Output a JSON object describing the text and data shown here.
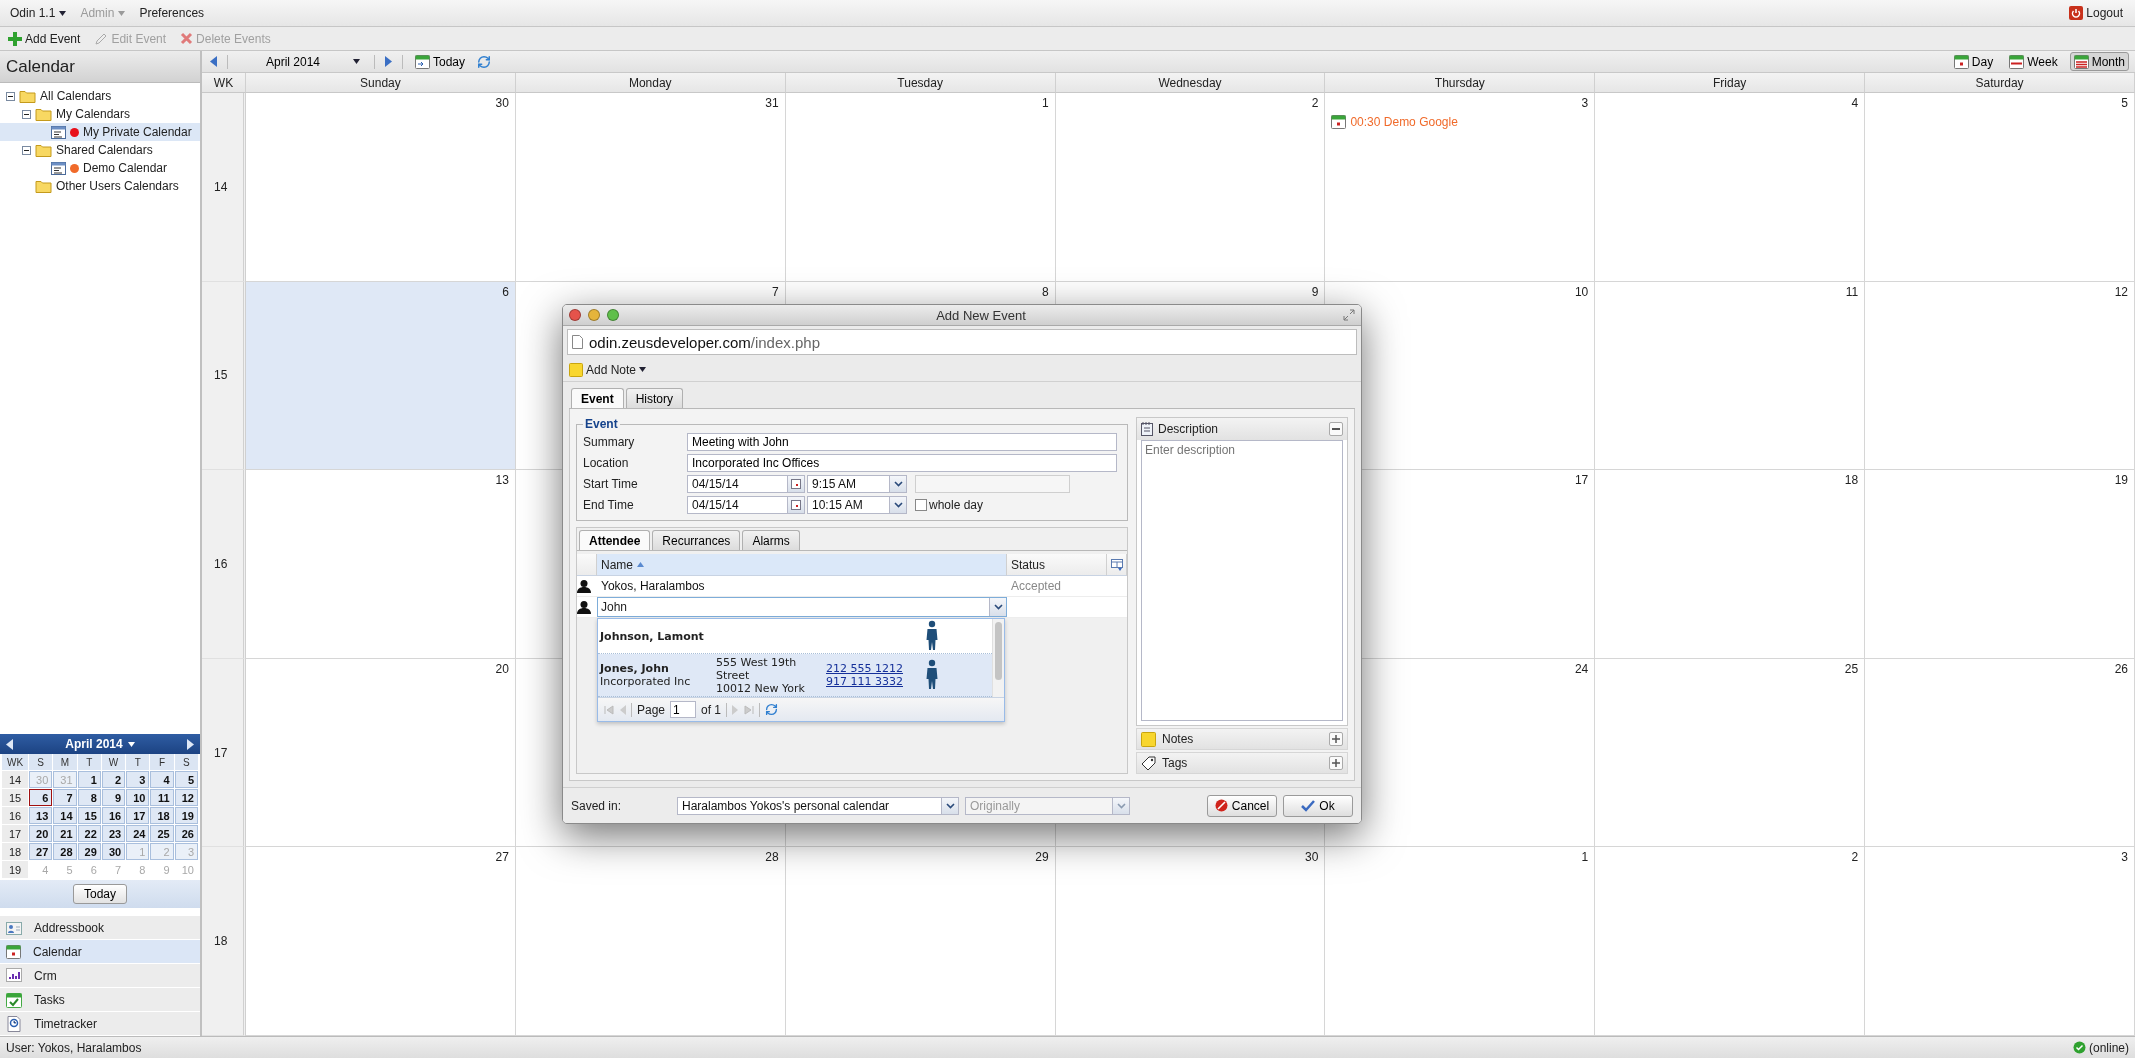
{
  "menu": [
    {
      "label": "Odin 1.1",
      "dropdown": true,
      "disabled": false
    },
    {
      "label": "Admin",
      "dropdown": true,
      "disabled": true
    },
    {
      "label": "Preferences",
      "dropdown": false,
      "disabled": false
    }
  ],
  "logout": {
    "label": "Logout"
  },
  "toolbar": [
    {
      "label": "Add Event",
      "kind": "add",
      "disabled": false
    },
    {
      "label": "Edit Event",
      "kind": "edit",
      "disabled": true
    },
    {
      "label": "Delete Events",
      "kind": "delete",
      "disabled": true
    }
  ],
  "sidebar": {
    "title": "Calendar",
    "tree": [
      {
        "label": "All Calendars",
        "kind": "folder",
        "expanded": true,
        "selected": false,
        "children": [
          {
            "label": "My Calendars",
            "kind": "folder",
            "expanded": true,
            "selected": false,
            "children": [
              {
                "label": "My Private Calendar",
                "kind": "calendar",
                "color": "#e8101a",
                "selected": true
              }
            ]
          },
          {
            "label": "Shared Calendars",
            "kind": "folder",
            "expanded": true,
            "selected": false,
            "children": [
              {
                "label": "Demo Calendar",
                "kind": "calendar",
                "color": "#f06a2a",
                "selected": false
              }
            ]
          },
          {
            "label": "Other Users Calendars",
            "kind": "folder",
            "selected": false
          }
        ]
      }
    ],
    "mini_calendar": {
      "title": "April 2014",
      "headers": [
        "WK",
        "S",
        "M",
        "T",
        "W",
        "T",
        "F",
        "S"
      ],
      "today_button": "Today",
      "weeks": [
        {
          "wk": "14",
          "days": [
            {
              "label": "30",
              "kind": "adjacent",
              "selected": false
            },
            {
              "label": "31",
              "kind": "adjacent",
              "selected": false
            },
            {
              "label": "1",
              "kind": "month",
              "selected": false
            },
            {
              "label": "2",
              "kind": "month",
              "selected": false
            },
            {
              "label": "3",
              "kind": "month",
              "selected": false
            },
            {
              "label": "4",
              "kind": "month",
              "selected": false
            },
            {
              "label": "5",
              "kind": "month",
              "selected": false
            }
          ]
        },
        {
          "wk": "15",
          "days": [
            {
              "label": "6",
              "kind": "month",
              "selected": true
            },
            {
              "label": "7",
              "kind": "month",
              "selected": false
            },
            {
              "label": "8",
              "kind": "month",
              "selected": false
            },
            {
              "label": "9",
              "kind": "month",
              "selected": false
            },
            {
              "label": "10",
              "kind": "month",
              "selected": false
            },
            {
              "label": "11",
              "kind": "month",
              "selected": false
            },
            {
              "label": "12",
              "kind": "month",
              "selected": false
            }
          ]
        },
        {
          "wk": "16",
          "days": [
            {
              "label": "13",
              "kind": "month",
              "selected": false
            },
            {
              "label": "14",
              "kind": "month",
              "selected": false
            },
            {
              "label": "15",
              "kind": "month",
              "selected": false
            },
            {
              "label": "16",
              "kind": "month",
              "selected": false
            },
            {
              "label": "17",
              "kind": "month",
              "selected": false
            },
            {
              "label": "18",
              "kind": "month",
              "selected": false
            },
            {
              "label": "19",
              "kind": "month",
              "selected": false
            }
          ]
        },
        {
          "wk": "17",
          "days": [
            {
              "label": "20",
              "kind": "month",
              "selected": false
            },
            {
              "label": "21",
              "kind": "month",
              "selected": false
            },
            {
              "label": "22",
              "kind": "month",
              "selected": false
            },
            {
              "label": "23",
              "kind": "month",
              "selected": false
            },
            {
              "label": "24",
              "kind": "month",
              "selected": false
            },
            {
              "label": "25",
              "kind": "month",
              "selected": false
            },
            {
              "label": "26",
              "kind": "month",
              "selected": false
            }
          ]
        },
        {
          "wk": "18",
          "days": [
            {
              "label": "27",
              "kind": "month",
              "selected": false
            },
            {
              "label": "28",
              "kind": "month",
              "selected": false
            },
            {
              "label": "29",
              "kind": "month",
              "selected": false
            },
            {
              "label": "30",
              "kind": "month",
              "selected": false
            },
            {
              "label": "1",
              "kind": "adjacent",
              "selected": false
            },
            {
              "label": "2",
              "kind": "adjacent",
              "selected": false
            },
            {
              "label": "3",
              "kind": "adjacent",
              "selected": false
            }
          ]
        },
        {
          "wk": "19",
          "days": [
            {
              "label": "4",
              "kind": "outside",
              "selected": false
            },
            {
              "label": "5",
              "kind": "outside",
              "selected": false
            },
            {
              "label": "6",
              "kind": "outside",
              "selected": false
            },
            {
              "label": "7",
              "kind": "outside",
              "selected": false
            },
            {
              "label": "8",
              "kind": "outside",
              "selected": false
            },
            {
              "label": "9",
              "kind": "outside",
              "selected": false
            },
            {
              "label": "10",
              "kind": "outside",
              "selected": false
            }
          ]
        }
      ]
    },
    "apps": [
      {
        "label": "Addressbook",
        "kind": "addressbook",
        "selected": false
      },
      {
        "label": "Calendar",
        "kind": "calendar",
        "selected": true
      },
      {
        "label": "Crm",
        "kind": "crm",
        "selected": false
      },
      {
        "label": "Tasks",
        "kind": "tasks",
        "selected": false
      },
      {
        "label": "Timetracker",
        "kind": "timetracker",
        "selected": false
      }
    ]
  },
  "calendar": {
    "month_label": "April 2014",
    "today_button": "Today",
    "views": [
      {
        "label": "Day",
        "kind": "day",
        "selected": false
      },
      {
        "label": "Week",
        "kind": "week",
        "selected": false
      },
      {
        "label": "Month",
        "kind": "month",
        "selected": true
      }
    ],
    "wk_header": "WK",
    "weekdays": [
      "Sunday",
      "Monday",
      "Tuesday",
      "Wednesday",
      "Thursday",
      "Friday",
      "Saturday"
    ],
    "weeks": [
      {
        "wk": "14",
        "days": [
          {
            "label": "30",
            "selected": false
          },
          {
            "label": "31",
            "selected": false
          },
          {
            "label": "1",
            "selected": false
          },
          {
            "label": "2",
            "selected": false
          },
          {
            "label": "3",
            "selected": false,
            "events": [
              {
                "text": "00:30 Demo Google",
                "color": "#f06a2a"
              }
            ]
          },
          {
            "label": "4",
            "selected": false
          },
          {
            "label": "5",
            "selected": false
          }
        ]
      },
      {
        "wk": "15",
        "days": [
          {
            "label": "6",
            "selected": true
          },
          {
            "label": "7",
            "selected": false
          },
          {
            "label": "8",
            "selected": false
          },
          {
            "label": "9",
            "selected": false
          },
          {
            "label": "10",
            "selected": false
          },
          {
            "label": "11",
            "selected": false
          },
          {
            "label": "12",
            "selected": false
          }
        ]
      },
      {
        "wk": "16",
        "days": [
          {
            "label": "13",
            "selected": false
          },
          {
            "label": "17",
            "selected": false
          },
          {
            "label": "18",
            "selected": false
          },
          {
            "label": "19",
            "selected": false
          }
        ]
      },
      {
        "wk": "17",
        "days": [
          {
            "label": "20",
            "selected": false
          },
          {
            "label": "24",
            "selected": false
          },
          {
            "label": "25",
            "selected": false
          },
          {
            "label": "26",
            "selected": false
          }
        ]
      },
      {
        "wk": "18",
        "days": [
          {
            "label": "27",
            "selected": false
          },
          {
            "label": "28",
            "selected": false
          },
          {
            "label": "29",
            "selected": false
          },
          {
            "label": "30",
            "selected": false
          },
          {
            "label": "1",
            "selected": false
          },
          {
            "label": "2",
            "selected": false
          },
          {
            "label": "3",
            "selected": false
          }
        ]
      }
    ]
  },
  "dialog": {
    "title": "Add New Event",
    "url_host": "odin.zeusdeveloper.com",
    "url_path": "/index.php",
    "add_note": "Add Note",
    "tabs": [
      {
        "label": "Event",
        "selected": true
      },
      {
        "label": "History",
        "selected": false
      }
    ],
    "event_legend": "Event",
    "summary": {
      "label": "Summary",
      "value": "Meeting with John"
    },
    "location": {
      "label": "Location",
      "value": "Incorporated Inc Offices"
    },
    "start": {
      "label": "Start Time",
      "date": "04/15/14",
      "time": "9:15 AM"
    },
    "end": {
      "label": "End Time",
      "date": "04/15/14",
      "time": "10:15 AM"
    },
    "whole_day": {
      "label": "whole day",
      "checked": false
    },
    "sub_tabs": [
      {
        "label": "Attendee",
        "selected": true
      },
      {
        "label": "Recurrances",
        "selected": false
      },
      {
        "label": "Alarms",
        "selected": false
      }
    ],
    "columns": [
      {
        "label": "Name",
        "sorted_ascending": true
      },
      {
        "label": "Status"
      }
    ],
    "attendees": [
      {
        "name": "Yokos, Haralambos",
        "status": "Accepted"
      }
    ],
    "attendee_input": {
      "value": "John"
    },
    "suggestions": [
      {
        "name": "Johnson, Lamont",
        "selected": false
      },
      {
        "name": "Jones, John",
        "company": "Incorporated Inc",
        "address": [
          "555 West 19th Street",
          "10012 New York"
        ],
        "phones": [
          "212 555 1212",
          "917 111 3332"
        ],
        "selected": true
      }
    ],
    "pager": {
      "label": "Page",
      "page": "1",
      "of": "of 1"
    },
    "description": {
      "title": "Description",
      "placeholder": "Enter description"
    },
    "panels": [
      {
        "label": "Notes",
        "kind": "notes"
      },
      {
        "label": "Tags",
        "kind": "tags"
      }
    ],
    "saved_in": {
      "label": "Saved in:",
      "value": "Haralambos Yokos's personal calendar"
    },
    "originally": {
      "placeholder": "Originally",
      "disabled": true
    },
    "buttons": [
      {
        "label": "Cancel",
        "kind": "cancel"
      },
      {
        "label": "Ok",
        "kind": "ok"
      }
    ]
  },
  "status_bar": {
    "user": "User: Yokos, Haralambos",
    "connection": "(online)"
  }
}
